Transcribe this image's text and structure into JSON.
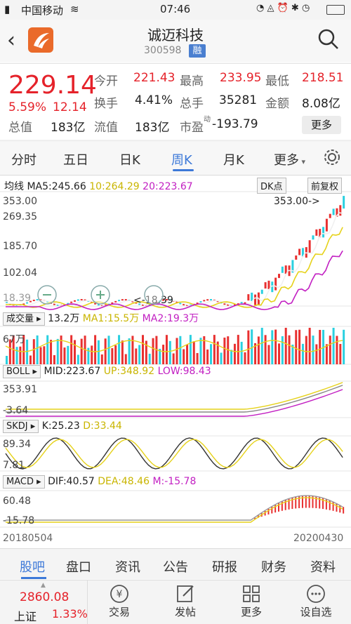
{
  "status": {
    "carrier": "中国移动",
    "time": "07:46"
  },
  "header": {
    "title": "诚迈科技",
    "code": "300598",
    "badge": "融"
  },
  "quote": {
    "price": "229.14",
    "pct": "5.59%",
    "change": "12.14",
    "open_label": "今开",
    "open": "221.43",
    "high_label": "最高",
    "high": "233.95",
    "low_label": "最低",
    "low": "218.51",
    "turnover_label": "换手",
    "turnover": "4.41%",
    "volume_label": "总手",
    "volume": "35281",
    "amount_label": "金额",
    "amount": "8.08亿",
    "mcap_label": "总值",
    "mcap": "183亿",
    "float_label": "流值",
    "float": "183亿",
    "pe_label": "市盈",
    "pe_sup": "动",
    "pe": "-193.79",
    "more": "更多"
  },
  "tabs": [
    {
      "label": "分时",
      "active": false
    },
    {
      "label": "五日",
      "active": false
    },
    {
      "label": "日K",
      "active": false
    },
    {
      "label": "周K",
      "active": true
    },
    {
      "label": "月K",
      "active": false
    },
    {
      "label": "更多",
      "active": false
    }
  ],
  "chart_data": [
    {
      "type": "line",
      "name": "K线",
      "legend": {
        "label": "均线",
        "ma5": "MA5:245.66",
        "ma10": "10:264.29",
        "ma20": "20:223.67"
      },
      "buttons": {
        "dk": "DK点",
        "fq": "前复权"
      },
      "y_ticks": [
        "353.00",
        "269.35",
        "185.70",
        "102.04",
        "18.39"
      ],
      "annotations": {
        "max": "353.00->",
        "min": "<-18.39"
      },
      "colors": {
        "ma5": "#ffffff",
        "ma10": "#f2e21d",
        "ma20": "#d02ad0"
      }
    },
    {
      "type": "bar",
      "name": "成交量",
      "legend": {
        "label": "成交量",
        "v": "13.2万",
        "ma1": "MA1:15.5万",
        "ma2": "MA2:19.3万"
      },
      "y_ticks": [
        "67万"
      ],
      "colors": {
        "up": "#e83030",
        "down": "#2ad0e0"
      }
    },
    {
      "type": "line",
      "name": "BOLL",
      "legend": {
        "label": "BOLL",
        "mid": "MID:223.67",
        "up": "UP:348.92",
        "low": "LOW:98.43"
      },
      "y_ticks": [
        "353.91",
        "-3.64"
      ]
    },
    {
      "type": "line",
      "name": "SKDJ",
      "legend": {
        "label": "SKDJ",
        "k": "K:25.23",
        "d": "D:33.44"
      },
      "y_ticks": [
        "89.34",
        "7.81"
      ]
    },
    {
      "type": "line",
      "name": "MACD",
      "legend": {
        "label": "MACD",
        "dif": "DIF:40.57",
        "dea": "DEA:48.46",
        "m": "M:-15.78"
      },
      "y_ticks": [
        "60.48",
        "-15.78"
      ]
    }
  ],
  "x_axis": {
    "start": "20180504",
    "end": "20200430"
  },
  "bottom_nav": [
    {
      "label": "股吧",
      "active": true
    },
    {
      "label": "盘口",
      "active": false
    },
    {
      "label": "资讯",
      "active": false
    },
    {
      "label": "公告",
      "active": false
    },
    {
      "label": "研报",
      "active": false
    },
    {
      "label": "财务",
      "active": false
    },
    {
      "label": "资料",
      "active": false
    }
  ],
  "footer": {
    "index_value": "2860.08",
    "index_name": "上证",
    "index_pct": "1.33%",
    "items": [
      {
        "label": "交易",
        "icon": "yen-icon"
      },
      {
        "label": "发帖",
        "icon": "edit-icon"
      },
      {
        "label": "更多",
        "icon": "grid-icon"
      },
      {
        "label": "设自选",
        "icon": "dots-icon"
      }
    ]
  }
}
